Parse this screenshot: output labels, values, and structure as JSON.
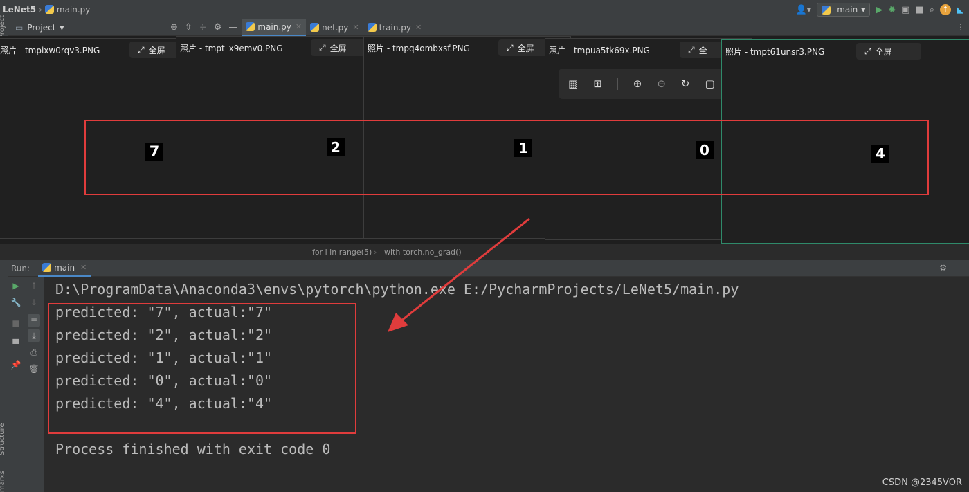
{
  "navbar": {
    "project": "LeNet5",
    "file": "main.py",
    "run_config": "main"
  },
  "left_stripe": {
    "top_label": "Project",
    "structure_label": "Structure",
    "bookmarks_label": "Bookmarks"
  },
  "tabbar": {
    "project_label": "Project",
    "tabs": [
      {
        "label": "main.py",
        "active": true
      },
      {
        "label": "net.py",
        "active": false
      },
      {
        "label": "train.py",
        "active": false
      }
    ]
  },
  "photos": [
    {
      "title": "照片 - tmpixw0rqv3.PNG",
      "fullscreen": "全屏",
      "digit": "7"
    },
    {
      "title": "照片 - tmpt_x9emv0.PNG",
      "fullscreen": "全屏",
      "digit": "2"
    },
    {
      "title": "照片 - tmpq4ombxsf.PNG",
      "fullscreen": "全屏",
      "digit": "1"
    },
    {
      "title": "照片 - tmpua5tk69x.PNG",
      "fullscreen": "全",
      "digit": "0"
    },
    {
      "title": "照片 - tmpt61unsr3.PNG",
      "fullscreen": "全屏",
      "digit": "4"
    }
  ],
  "breadcrumbs": {
    "first": "for i in range(5)",
    "second": "with torch.no_grad()"
  },
  "run": {
    "label": "Run:",
    "tab": "main",
    "lines": [
      "D:\\ProgramData\\Anaconda3\\envs\\pytorch\\python.exe E:/PycharmProjects/LeNet5/main.py",
      "predicted: \"7\", actual:\"7\"",
      "predicted: \"2\", actual:\"2\"",
      "predicted: \"1\", actual:\"1\"",
      "predicted: \"0\", actual:\"0\"",
      "predicted: \"4\", actual:\"4\"",
      "Process finished with exit code 0"
    ]
  },
  "watermark": "CSDN @2345VOR",
  "colors": {
    "annotation_red": "#e03c3c",
    "accent_blue": "#4a88c7"
  }
}
